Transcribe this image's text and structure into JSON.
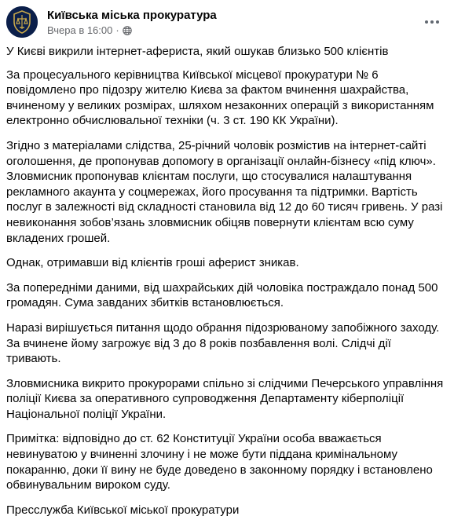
{
  "post": {
    "author": "Київська міська прокуратура",
    "time": "Вчера в 16:00",
    "separator": "·",
    "avatar_icon": "prosecutor-emblem-icon",
    "privacy_icon": "globe-icon",
    "more_icon": "more-options-icon",
    "paragraphs": [
      "У Києві викрили інтернет-афериста, який ошукав близько 500 клієнтів",
      "За процесуального керівництва Київської місцевої прокуратури № 6 повідомлено про підозру жителю Києва за фактом вчинення шахрайства, вчиненому у великих розмірах, шляхом незаконних операцій з використанням електронно обчислювальної техніки (ч. 3 ст. 190 КК України).",
      "Згідно з матеріалами слідства, 25-річний чоловік розмістив на інтернет-сайті оголошення, де пропонував допомогу в організації онлайн-бізнесу «під ключ». Зловмисник пропонував клієнтам послуги, що стосувалися налаштування рекламного акаунта у соцмережах, його просування та підтримки. Вартість послуг в залежності від складності становила від 12 до 60 тисяч гривень. У разі невиконання зобов’язань зловмисник обіцяв повернути клієнтам всю суму вкладених грошей.",
      "Однак, отримавши від клієнтів гроші аферист зникав.",
      "За попередніми даними, від шахрайських дій чоловіка постраждало понад 500 громадян. Сума завданих збитків встановлюється.",
      "Наразі вирішується питання щодо обрання підозрюваному запобіжного заходу. За вчинене йому загрожує від 3 до 8 років позбавлення волі. Слідчі дії тривають.",
      "Зловмисника викрито прокурорами спільно зі слідчими Печерського управління поліції Києва за оперативного супроводження Департаменту кіберполіції Національної поліції України.",
      "Примітка: відповідно до ст. 62 Конституції України особа вважається невинуватою у вчиненні злочину і не може бути піддана кримінальному покаранню, доки її вину не буде доведено в законному порядку і встановлено обвинувальним вироком суду.",
      "Пресслужба Київської міської прокуратури"
    ]
  }
}
